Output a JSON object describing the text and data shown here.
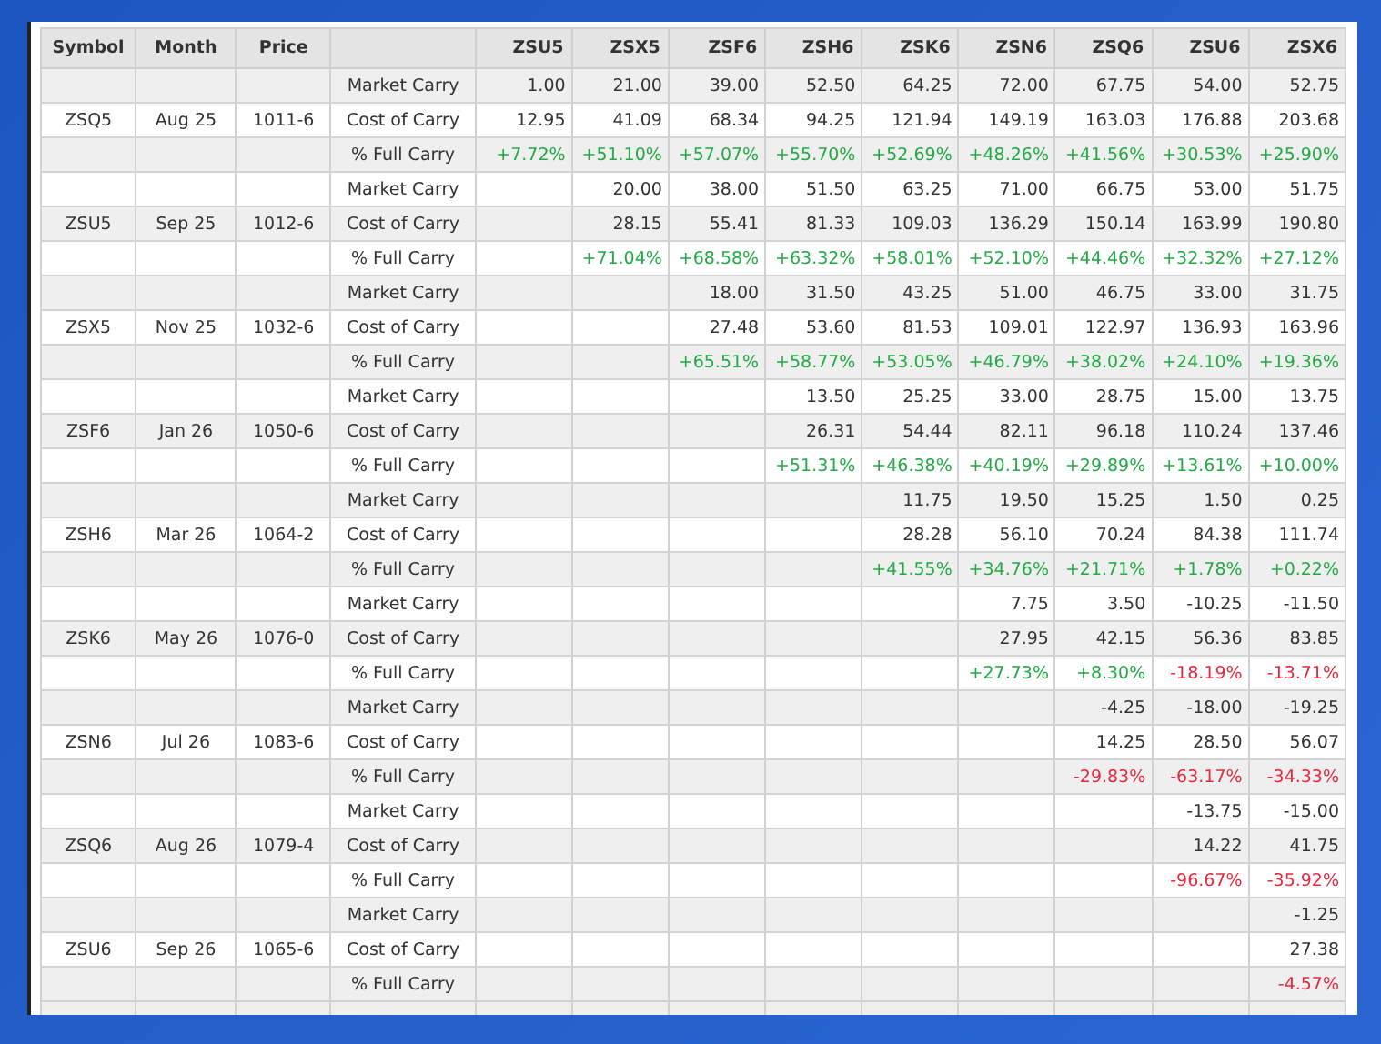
{
  "table": {
    "columns": [
      "Symbol",
      "Month",
      "Price"
    ],
    "contract_columns": [
      "ZSU5",
      "ZSX5",
      "ZSF6",
      "ZSH6",
      "ZSK6",
      "ZSN6",
      "ZSQ6",
      "ZSU6",
      "ZSX6"
    ],
    "rows": [
      {
        "kind": "market",
        "label": "Market Carry",
        "values": [
          "1.00",
          "21.00",
          "39.00",
          "52.50",
          "64.25",
          "72.00",
          "67.75",
          "54.00",
          "52.75"
        ]
      },
      {
        "kind": "cost",
        "symbol": "ZSQ5",
        "month": "Aug 25",
        "price": "1011-6",
        "label": "Cost of Carry",
        "values": [
          "12.95",
          "41.09",
          "68.34",
          "94.25",
          "121.94",
          "149.19",
          "163.03",
          "176.88",
          "203.68"
        ]
      },
      {
        "kind": "percent",
        "label": "% Full Carry",
        "values": [
          {
            "text": "+7.72%",
            "positive": true
          },
          {
            "text": "+51.10%",
            "positive": true
          },
          {
            "text": "+57.07%",
            "positive": true
          },
          {
            "text": "+55.70%",
            "positive": true
          },
          {
            "text": "+52.69%",
            "positive": true
          },
          {
            "text": "+48.26%",
            "positive": true
          },
          {
            "text": "+41.56%",
            "positive": true
          },
          {
            "text": "+30.53%",
            "positive": true
          },
          {
            "text": "+25.90%",
            "positive": true
          }
        ]
      },
      {
        "kind": "market",
        "label": "Market Carry",
        "values": [
          "20.00",
          "38.00",
          "51.50",
          "63.25",
          "71.00",
          "66.75",
          "53.00",
          "51.75"
        ]
      },
      {
        "kind": "cost",
        "symbol": "ZSU5",
        "month": "Sep 25",
        "price": "1012-6",
        "label": "Cost of Carry",
        "values": [
          "28.15",
          "55.41",
          "81.33",
          "109.03",
          "136.29",
          "150.14",
          "163.99",
          "190.80"
        ]
      },
      {
        "kind": "percent",
        "label": "% Full Carry",
        "values": [
          {
            "text": "+71.04%",
            "positive": true
          },
          {
            "text": "+68.58%",
            "positive": true
          },
          {
            "text": "+63.32%",
            "positive": true
          },
          {
            "text": "+58.01%",
            "positive": true
          },
          {
            "text": "+52.10%",
            "positive": true
          },
          {
            "text": "+44.46%",
            "positive": true
          },
          {
            "text": "+32.32%",
            "positive": true
          },
          {
            "text": "+27.12%",
            "positive": true
          }
        ]
      },
      {
        "kind": "market",
        "label": "Market Carry",
        "values": [
          "18.00",
          "31.50",
          "43.25",
          "51.00",
          "46.75",
          "33.00",
          "31.75"
        ]
      },
      {
        "kind": "cost",
        "symbol": "ZSX5",
        "month": "Nov 25",
        "price": "1032-6",
        "label": "Cost of Carry",
        "values": [
          "27.48",
          "53.60",
          "81.53",
          "109.01",
          "122.97",
          "136.93",
          "163.96"
        ]
      },
      {
        "kind": "percent",
        "label": "% Full Carry",
        "values": [
          {
            "text": "+65.51%",
            "positive": true
          },
          {
            "text": "+58.77%",
            "positive": true
          },
          {
            "text": "+53.05%",
            "positive": true
          },
          {
            "text": "+46.79%",
            "positive": true
          },
          {
            "text": "+38.02%",
            "positive": true
          },
          {
            "text": "+24.10%",
            "positive": true
          },
          {
            "text": "+19.36%",
            "positive": true
          }
        ]
      },
      {
        "kind": "market",
        "label": "Market Carry",
        "values": [
          "13.50",
          "25.25",
          "33.00",
          "28.75",
          "15.00",
          "13.75"
        ]
      },
      {
        "kind": "cost",
        "symbol": "ZSF6",
        "month": "Jan 26",
        "price": "1050-6",
        "label": "Cost of Carry",
        "values": [
          "26.31",
          "54.44",
          "82.11",
          "96.18",
          "110.24",
          "137.46"
        ]
      },
      {
        "kind": "percent",
        "label": "% Full Carry",
        "values": [
          {
            "text": "+51.31%",
            "positive": true
          },
          {
            "text": "+46.38%",
            "positive": true
          },
          {
            "text": "+40.19%",
            "positive": true
          },
          {
            "text": "+29.89%",
            "positive": true
          },
          {
            "text": "+13.61%",
            "positive": true
          },
          {
            "text": "+10.00%",
            "positive": true
          }
        ]
      },
      {
        "kind": "market",
        "label": "Market Carry",
        "values": [
          "11.75",
          "19.50",
          "15.25",
          "1.50",
          "0.25"
        ]
      },
      {
        "kind": "cost",
        "symbol": "ZSH6",
        "month": "Mar 26",
        "price": "1064-2",
        "label": "Cost of Carry",
        "values": [
          "28.28",
          "56.10",
          "70.24",
          "84.38",
          "111.74"
        ]
      },
      {
        "kind": "percent",
        "label": "% Full Carry",
        "values": [
          {
            "text": "+41.55%",
            "positive": true
          },
          {
            "text": "+34.76%",
            "positive": true
          },
          {
            "text": "+21.71%",
            "positive": true
          },
          {
            "text": "+1.78%",
            "positive": true
          },
          {
            "text": "+0.22%",
            "positive": true
          }
        ]
      },
      {
        "kind": "market",
        "label": "Market Carry",
        "values": [
          "7.75",
          "3.50",
          "-10.25",
          "-11.50"
        ]
      },
      {
        "kind": "cost",
        "symbol": "ZSK6",
        "month": "May 26",
        "price": "1076-0",
        "label": "Cost of Carry",
        "values": [
          "27.95",
          "42.15",
          "56.36",
          "83.85"
        ]
      },
      {
        "kind": "percent",
        "label": "% Full Carry",
        "values": [
          {
            "text": "+27.73%",
            "positive": true
          },
          {
            "text": "+8.30%",
            "positive": true
          },
          {
            "text": "-18.19%",
            "positive": false
          },
          {
            "text": "-13.71%",
            "positive": false
          }
        ]
      },
      {
        "kind": "market",
        "label": "Market Carry",
        "values": [
          "-4.25",
          "-18.00",
          "-19.25"
        ]
      },
      {
        "kind": "cost",
        "symbol": "ZSN6",
        "month": "Jul 26",
        "price": "1083-6",
        "label": "Cost of Carry",
        "values": [
          "14.25",
          "28.50",
          "56.07"
        ]
      },
      {
        "kind": "percent",
        "label": "% Full Carry",
        "values": [
          {
            "text": "-29.83%",
            "positive": false
          },
          {
            "text": "-63.17%",
            "positive": false
          },
          {
            "text": "-34.33%",
            "positive": false
          }
        ]
      },
      {
        "kind": "market",
        "label": "Market Carry",
        "values": [
          "-13.75",
          "-15.00"
        ]
      },
      {
        "kind": "cost",
        "symbol": "ZSQ6",
        "month": "Aug 26",
        "price": "1079-4",
        "label": "Cost of Carry",
        "values": [
          "14.22",
          "41.75"
        ]
      },
      {
        "kind": "percent",
        "label": "% Full Carry",
        "values": [
          {
            "text": "-96.67%",
            "positive": false
          },
          {
            "text": "-35.92%",
            "positive": false
          }
        ]
      },
      {
        "kind": "market",
        "label": "Market Carry",
        "values": [
          "-1.25"
        ]
      },
      {
        "kind": "cost",
        "symbol": "ZSU6",
        "month": "Sep 26",
        "price": "1065-6",
        "label": "Cost of Carry",
        "values": [
          "27.38"
        ]
      },
      {
        "kind": "percent",
        "label": "% Full Carry",
        "values": [
          {
            "text": "-4.57%",
            "positive": false
          }
        ]
      }
    ]
  }
}
